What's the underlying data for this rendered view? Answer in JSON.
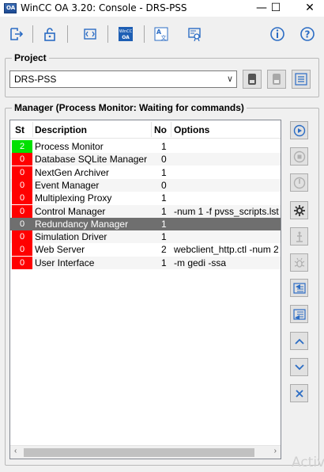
{
  "window": {
    "title": "WinCC OA 3.20: Console - DRS-PSS",
    "minimize": "—",
    "maximize": "☐",
    "close": "✕"
  },
  "toolbar": {
    "icons": [
      "exit-icon",
      "lock-icon",
      "log-viewer-icon",
      "wincc-oa-icon",
      "language-icon",
      "certificate-icon",
      "info-icon",
      "help-icon"
    ],
    "wincc_label": "WinCC\nOA"
  },
  "project": {
    "group_title": "Project",
    "selected": "DRS-PSS"
  },
  "manager": {
    "group_title": "Manager  (Process Monitor: Waiting for commands)",
    "columns": [
      "St",
      "Description",
      "No",
      "Options"
    ],
    "rows": [
      {
        "st": "2",
        "status": "green",
        "description": "Process Monitor",
        "no": "1",
        "options": ""
      },
      {
        "st": "0",
        "status": "red",
        "description": "Database SQLite Manager",
        "no": "0",
        "options": ""
      },
      {
        "st": "0",
        "status": "red",
        "description": "NextGen Archiver",
        "no": "1",
        "options": ""
      },
      {
        "st": "0",
        "status": "red",
        "description": "Event Manager",
        "no": "0",
        "options": ""
      },
      {
        "st": "0",
        "status": "red",
        "description": "Multiplexing Proxy",
        "no": "1",
        "options": ""
      },
      {
        "st": "0",
        "status": "red",
        "description": "Control Manager",
        "no": "1",
        "options": "-num 1 -f pvss_scripts.lst"
      },
      {
        "st": "0",
        "status": "selected",
        "description": "Redundancy Manager",
        "no": "1",
        "options": ""
      },
      {
        "st": "0",
        "status": "red",
        "description": "Simulation Driver",
        "no": "1",
        "options": ""
      },
      {
        "st": "0",
        "status": "red",
        "description": "Web Server",
        "no": "2",
        "options": "webclient_http.ctl -num 2"
      },
      {
        "st": "0",
        "status": "red",
        "description": "User Interface",
        "no": "1",
        "options": "-m gedi -ssa"
      }
    ],
    "scroll_left": "‹",
    "scroll_right": "›"
  },
  "side_buttons": [
    "start-icon",
    "stop-icon",
    "kill-icon",
    "settings-icon",
    "debug-icon",
    "debug-flag-icon",
    "insert-icon",
    "append-icon",
    "move-up-icon",
    "move-down-icon",
    "remove-icon"
  ],
  "colors": {
    "status_red": "#ff0000",
    "status_green": "#00e000",
    "selected_row": "#6f6f6f",
    "accent_blue": "#2b6cc4"
  },
  "watermark": "Activ"
}
